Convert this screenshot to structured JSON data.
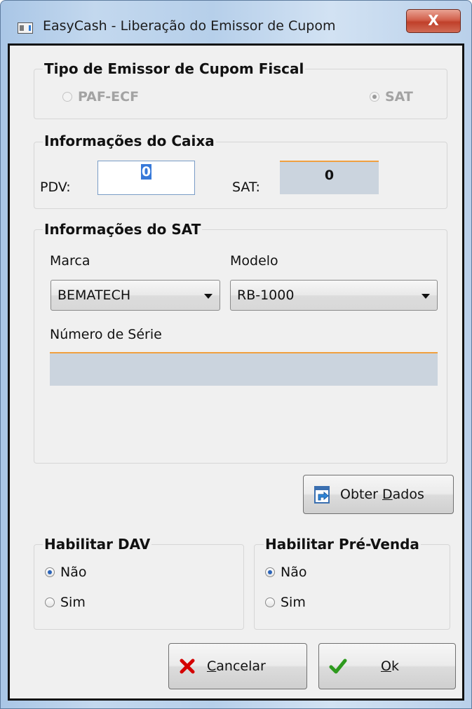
{
  "window": {
    "title": "EasyCash - Liberação do Emissor de Cupom",
    "close_label": "X"
  },
  "emissor": {
    "title": "Tipo de Emissor de Cupom Fiscal",
    "option_paf": "PAF-ECF",
    "option_sat": "SAT",
    "selected": "SAT"
  },
  "caixa": {
    "title": "Informações do Caixa",
    "pdv_label": "PDV:",
    "pdv_value": "0",
    "sat_label": "SAT:",
    "sat_value": "0"
  },
  "sat_info": {
    "title": "Informações do SAT",
    "marca_label": "Marca",
    "marca_value": "BEMATECH",
    "modelo_label": "Modelo",
    "modelo_value": "RB-1000",
    "serie_label": "Número de Série",
    "serie_value": ""
  },
  "obter_dados": {
    "prefix": "Obter ",
    "accel": "D",
    "suffix": "ados",
    "icon": "document-import-icon"
  },
  "dav": {
    "title": "Habilitar DAV",
    "option_nao": "Não",
    "option_sim": "Sim",
    "selected": "Não"
  },
  "prevenda": {
    "title": "Habilitar Pré-Venda",
    "option_nao": "Não",
    "option_sim": "Sim",
    "selected": "Não"
  },
  "buttons": {
    "cancel_accel": "C",
    "cancel_rest": "ancelar",
    "ok_accel": "O",
    "ok_rest": "k"
  },
  "colors": {
    "cancel_icon": "#d40000",
    "ok_icon": "#2e9a1e",
    "titlebar_close": "#c0402a"
  }
}
